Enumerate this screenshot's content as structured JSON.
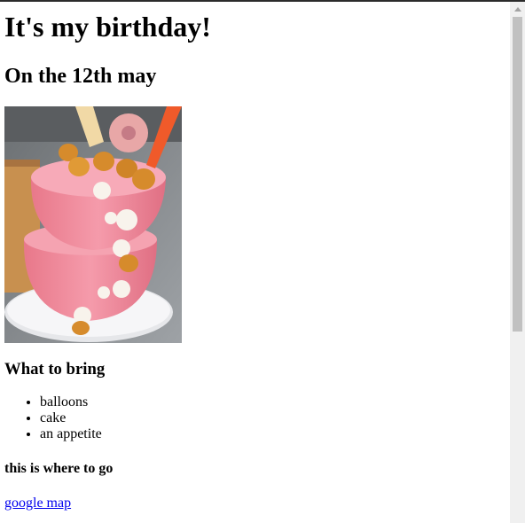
{
  "page": {
    "title": "It's my birthday!",
    "subtitle": "On the 12th may",
    "image_alt": "pink birthday cake",
    "bring_heading": "What to bring",
    "bring_items": [
      "balloons",
      "cake",
      "an appetite"
    ],
    "where_heading": "this is where to go",
    "map_link": "google map"
  },
  "colors": {
    "link": "#0000ee",
    "scrollbar_track": "#f0f0f0",
    "scrollbar_thumb": "#c1c1c1"
  }
}
